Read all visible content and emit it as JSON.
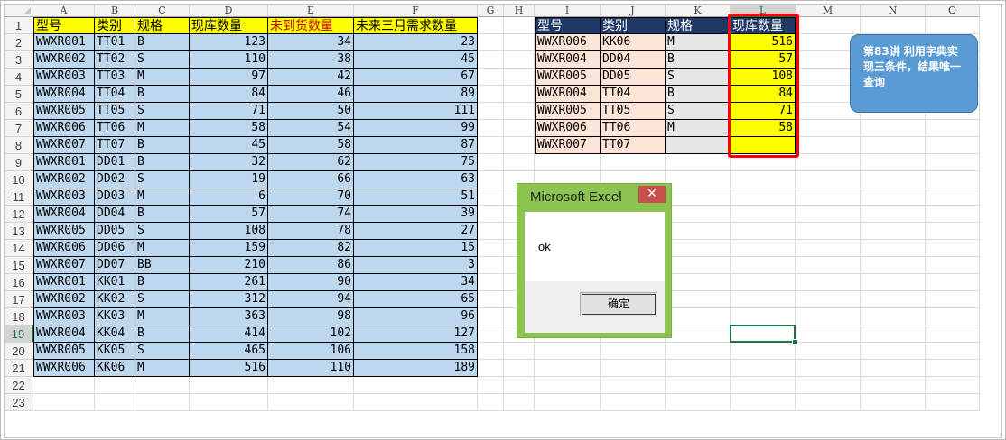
{
  "columns": [
    "A",
    "B",
    "C",
    "D",
    "E",
    "F",
    "G",
    "H",
    "I",
    "J",
    "K",
    "L",
    "M",
    "N",
    "O"
  ],
  "active_col": "L",
  "rows": [
    "1",
    "2",
    "3",
    "4",
    "5",
    "6",
    "7",
    "8",
    "9",
    "10",
    "11",
    "12",
    "13",
    "14",
    "15",
    "16",
    "17",
    "18",
    "19",
    "20",
    "21",
    "22",
    "23"
  ],
  "active_row": "19",
  "main_table": {
    "headers": [
      "型号",
      "类别",
      "规格",
      "现库数量",
      "未到货数量",
      "未来三月需求数量"
    ],
    "rows": [
      [
        "WWXR001",
        "TT01",
        "B",
        "123",
        "34",
        "23"
      ],
      [
        "WWXR002",
        "TT02",
        "S",
        "110",
        "38",
        "45"
      ],
      [
        "WWXR003",
        "TT03",
        "M",
        "97",
        "42",
        "67"
      ],
      [
        "WWXR004",
        "TT04",
        "B",
        "84",
        "46",
        "89"
      ],
      [
        "WWXR005",
        "TT05",
        "S",
        "71",
        "50",
        "111"
      ],
      [
        "WWXR006",
        "TT06",
        "M",
        "58",
        "54",
        "99"
      ],
      [
        "WWXR007",
        "TT07",
        "B",
        "45",
        "58",
        "87"
      ],
      [
        "WWXR001",
        "DD01",
        "B",
        "32",
        "62",
        "75"
      ],
      [
        "WWXR002",
        "DD02",
        "S",
        "19",
        "66",
        "63"
      ],
      [
        "WWXR003",
        "DD03",
        "M",
        "6",
        "70",
        "51"
      ],
      [
        "WWXR004",
        "DD04",
        "B",
        "57",
        "74",
        "39"
      ],
      [
        "WWXR005",
        "DD05",
        "S",
        "108",
        "78",
        "27"
      ],
      [
        "WWXR006",
        "DD06",
        "M",
        "159",
        "82",
        "15"
      ],
      [
        "WWXR007",
        "DD07",
        "BB",
        "210",
        "86",
        "3"
      ],
      [
        "WWXR001",
        "KK01",
        "B",
        "261",
        "90",
        "34"
      ],
      [
        "WWXR002",
        "KK02",
        "S",
        "312",
        "94",
        "65"
      ],
      [
        "WWXR003",
        "KK03",
        "M",
        "363",
        "98",
        "96"
      ],
      [
        "WWXR004",
        "KK04",
        "B",
        "414",
        "102",
        "127"
      ],
      [
        "WWXR005",
        "KK05",
        "S",
        "465",
        "106",
        "158"
      ],
      [
        "WWXR006",
        "KK06",
        "M",
        "516",
        "110",
        "189"
      ]
    ]
  },
  "lookup_table": {
    "headers": [
      "型号",
      "类别",
      "规格",
      "现库数量"
    ],
    "rows": [
      [
        "WWXR006",
        "KK06",
        "M",
        "516"
      ],
      [
        "WWXR004",
        "DD04",
        "B",
        "57"
      ],
      [
        "WWXR005",
        "DD05",
        "S",
        "108"
      ],
      [
        "WWXR004",
        "TT04",
        "B",
        "84"
      ],
      [
        "WWXR005",
        "TT05",
        "S",
        "71"
      ],
      [
        "WWXR006",
        "TT06",
        "M",
        "58"
      ],
      [
        "WWXR007",
        "TT07",
        "",
        ""
      ]
    ]
  },
  "callout": {
    "text": "第83讲 利用字典实现三条件，结果唯一查询"
  },
  "dialog": {
    "title": "Microsoft Excel",
    "close_glyph": "✕",
    "message": "ok",
    "ok_label": "确定"
  },
  "colors": {
    "header_yellow": "#ffff00",
    "data_blue": "#bdd7ee",
    "lookup_header_navy": "#1f3864",
    "lookup_peach": "#fce4d6",
    "highlight_red": "#ff0000",
    "excel_green": "#217346",
    "dialog_frame_green": "#8dc451",
    "callout_blue": "#5b9bd5"
  }
}
